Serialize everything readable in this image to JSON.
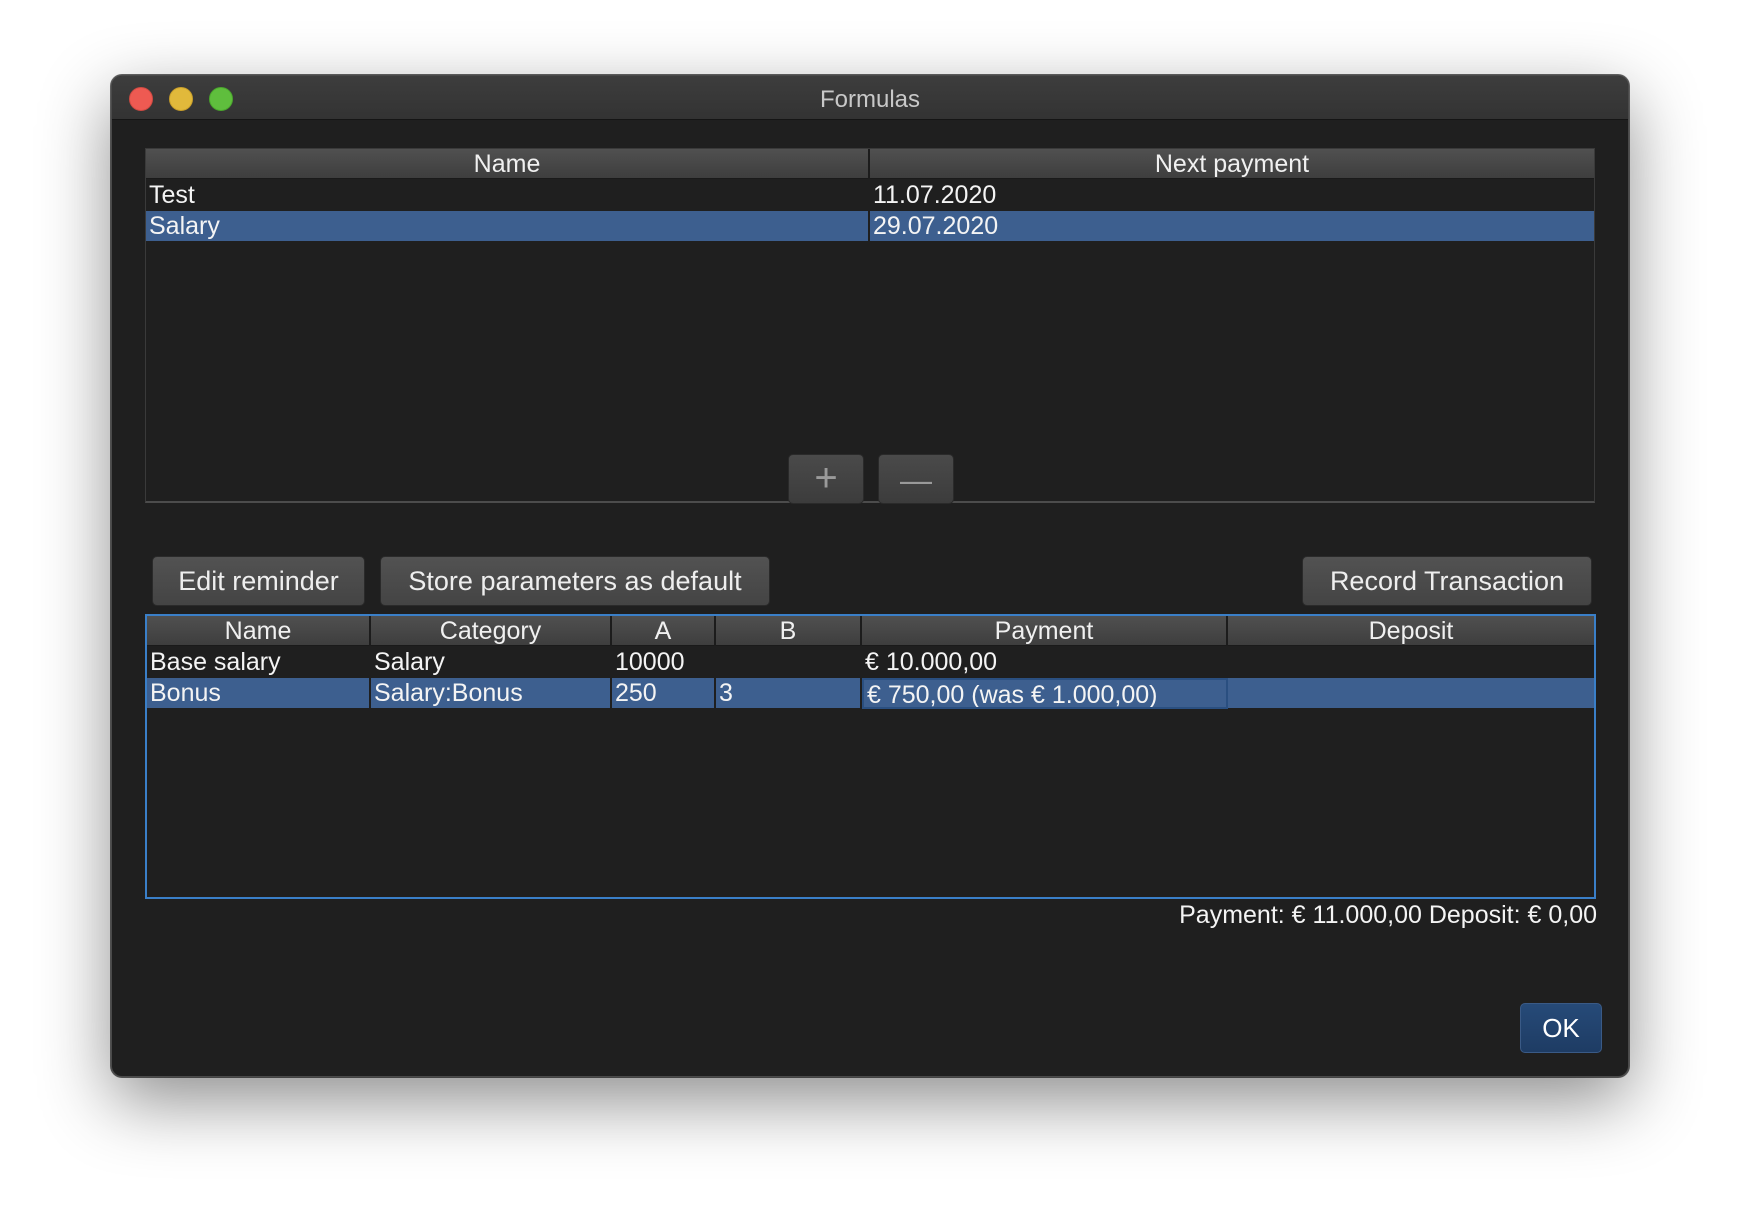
{
  "window": {
    "title": "Formulas"
  },
  "reminders_table": {
    "columns": [
      "Name",
      "Next payment"
    ],
    "rows": [
      {
        "name": "Test",
        "next_payment": "11.07.2020",
        "selected": false
      },
      {
        "name": "Salary",
        "next_payment": "29.07.2020",
        "selected": true
      }
    ]
  },
  "list_controls": {
    "add_label": "+",
    "remove_label": "—"
  },
  "toolbar": {
    "edit_reminder": "Edit reminder",
    "store_defaults": "Store parameters as default",
    "record_transaction": "Record Transaction"
  },
  "formula_table": {
    "columns": [
      "Name",
      "Category",
      "A",
      "B",
      "Payment",
      "Deposit"
    ],
    "rows": [
      {
        "name": "Base salary",
        "category": "Salary",
        "a": "10000",
        "b": "",
        "payment": "€ 10.000,00",
        "deposit": "",
        "selected": false
      },
      {
        "name": "Bonus",
        "category": "Salary:Bonus",
        "a": "250",
        "b": "3",
        "payment": "€ 750,00 (was € 1.000,00)",
        "deposit": "",
        "selected": true
      }
    ]
  },
  "totals": {
    "text": "Payment: € 11.000,00  Deposit: € 0,00"
  },
  "footer": {
    "ok_label": "OK"
  },
  "colors": {
    "selection": "#3d5f8f",
    "focus_border": "#3a7fc8",
    "window_bg": "#1f1f1f",
    "ok_button": "#264a78"
  }
}
